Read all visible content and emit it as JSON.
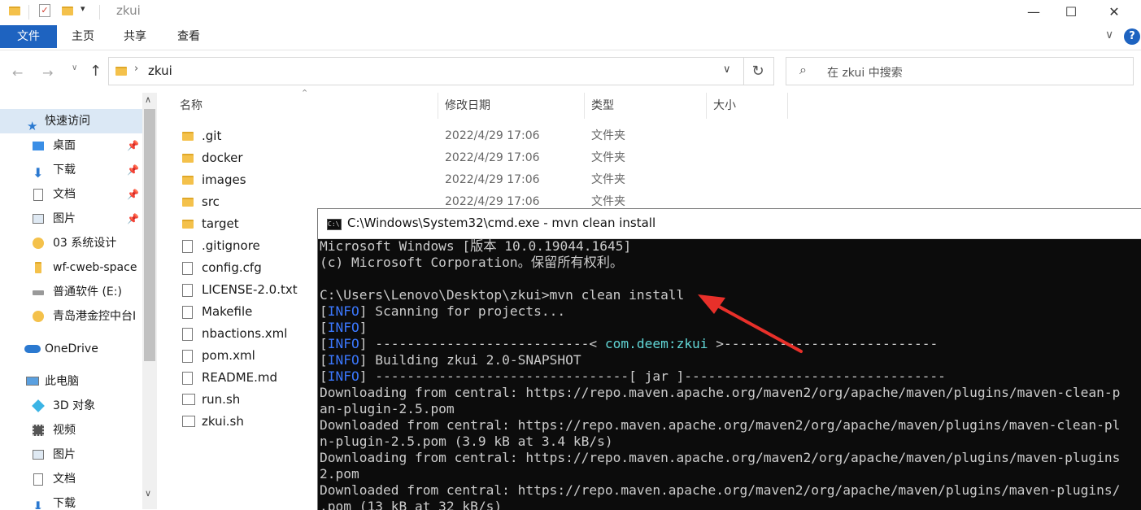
{
  "window": {
    "title": "zkui",
    "controls": [
      "minimize",
      "maximize",
      "close"
    ]
  },
  "ribbon": {
    "tabs": [
      "文件",
      "主页",
      "共享",
      "查看"
    ]
  },
  "address": {
    "path": "zkui",
    "search_placeholder": "在 zkui 中搜索"
  },
  "nav_pane": {
    "items": [
      {
        "label": "快速访问",
        "icon": "star-icon"
      },
      {
        "label": "桌面",
        "icon": "desktop-icon",
        "pinned": true
      },
      {
        "label": "下载",
        "icon": "download-icon",
        "pinned": true
      },
      {
        "label": "文档",
        "icon": "document-icon",
        "pinned": true
      },
      {
        "label": "图片",
        "icon": "picture-icon",
        "pinned": true
      },
      {
        "label": "03 系统设计",
        "icon": "sync-folder-icon"
      },
      {
        "label": "wf-cweb-space",
        "icon": "folder-icon"
      },
      {
        "label": "普通软件 (E:)",
        "icon": "drive-icon"
      },
      {
        "label": "青岛港金控中台I",
        "icon": "sync-folder-icon"
      },
      {
        "label": "OneDrive",
        "icon": "cloud-icon"
      },
      {
        "label": "此电脑",
        "icon": "computer-icon"
      },
      {
        "label": "3D 对象",
        "icon": "cube-icon"
      },
      {
        "label": "视频",
        "icon": "video-icon"
      },
      {
        "label": "图片",
        "icon": "picture-icon"
      },
      {
        "label": "文档",
        "icon": "document-icon"
      },
      {
        "label": "下载",
        "icon": "download-icon"
      }
    ]
  },
  "file_list": {
    "columns": [
      "名称",
      "修改日期",
      "类型",
      "大小"
    ],
    "rows": [
      {
        "name": ".git",
        "date": "2022/4/29 17:06",
        "type": "文件夹",
        "kind": "folder"
      },
      {
        "name": "docker",
        "date": "2022/4/29 17:06",
        "type": "文件夹",
        "kind": "folder"
      },
      {
        "name": "images",
        "date": "2022/4/29 17:06",
        "type": "文件夹",
        "kind": "folder"
      },
      {
        "name": "src",
        "date": "2022/4/29 17:06",
        "type": "文件夹",
        "kind": "folder"
      },
      {
        "name": "target",
        "date": "",
        "type": "",
        "kind": "folder"
      },
      {
        "name": ".gitignore",
        "date": "",
        "type": "",
        "kind": "file"
      },
      {
        "name": "config.cfg",
        "date": "",
        "type": "",
        "kind": "file"
      },
      {
        "name": "LICENSE-2.0.txt",
        "date": "",
        "type": "",
        "kind": "file"
      },
      {
        "name": "Makefile",
        "date": "",
        "type": "",
        "kind": "file"
      },
      {
        "name": "nbactions.xml",
        "date": "",
        "type": "",
        "kind": "file"
      },
      {
        "name": "pom.xml",
        "date": "",
        "type": "",
        "kind": "file"
      },
      {
        "name": "README.md",
        "date": "",
        "type": "",
        "kind": "file"
      },
      {
        "name": "run.sh",
        "date": "",
        "type": "",
        "kind": "script"
      },
      {
        "name": "zkui.sh",
        "date": "",
        "type": "",
        "kind": "script"
      }
    ]
  },
  "cmd": {
    "title": "C:\\Windows\\System32\\cmd.exe - mvn  clean install",
    "lines": [
      {
        "text": "Microsoft Windows [版本 10.0.19044.1645]"
      },
      {
        "text": "(c) Microsoft Corporation。保留所有权利。"
      },
      {
        "text": ""
      },
      {
        "text": "C:\\Users\\Lenovo\\Desktop\\zkui>mvn clean install"
      },
      {
        "tag": "INFO",
        "text": " Scanning for projects..."
      },
      {
        "tag": "INFO",
        "text": ""
      },
      {
        "tag": "INFO",
        "text": " ---------------------------< ",
        "pkg": "com.deem:zkui",
        "tail": " >---------------------------"
      },
      {
        "tag": "INFO",
        "text": " Building zkui 2.0-SNAPSHOT"
      },
      {
        "tag": "INFO",
        "text": " --------------------------------[ jar ]---------------------------------"
      },
      {
        "text": "Downloading from central: https://repo.maven.apache.org/maven2/org/apache/maven/plugins/maven-clean-p"
      },
      {
        "text": "an-plugin-2.5.pom"
      },
      {
        "text": "Downloaded from central: https://repo.maven.apache.org/maven2/org/apache/maven/plugins/maven-clean-pl"
      },
      {
        "text": "n-plugin-2.5.pom (3.9 kB at 3.4 kB/s)"
      },
      {
        "text": "Downloading from central: https://repo.maven.apache.org/maven2/org/apache/maven/plugins/maven-plugins"
      },
      {
        "text": "2.pom"
      },
      {
        "text": "Downloaded from central: https://repo.maven.apache.org/maven2/org/apache/maven/plugins/maven-plugins/"
      },
      {
        "text": ".pom (13 kB at 32 kB/s)"
      }
    ]
  },
  "colors": {
    "accent": "#1e63c0",
    "annotation_arrow": "#e8302a",
    "info_tag": "#3b78ff",
    "package_name": "#61d6d6"
  }
}
